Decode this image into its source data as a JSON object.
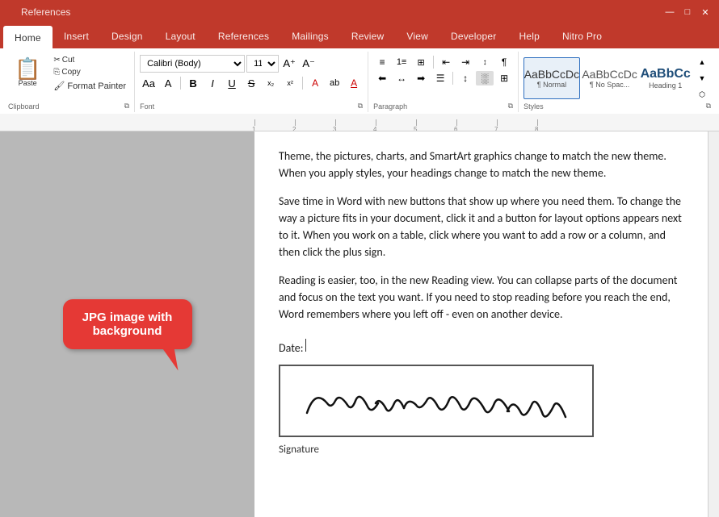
{
  "title_bar": {
    "tabs": [
      "References"
    ],
    "active_tab": "References"
  },
  "ribbon": {
    "tabs": [
      {
        "label": "Home",
        "active": true
      },
      {
        "label": "Insert"
      },
      {
        "label": "Design"
      },
      {
        "label": "Layout"
      },
      {
        "label": "References"
      },
      {
        "label": "Mailings"
      },
      {
        "label": "Review"
      },
      {
        "label": "View"
      },
      {
        "label": "Developer"
      },
      {
        "label": "Help"
      },
      {
        "label": "Nitro Pro"
      }
    ],
    "clipboard": {
      "paste_label": "Paste",
      "cut_label": "Cut",
      "copy_label": "Copy",
      "format_painter_label": "Format Painter",
      "group_label": "Clipboard"
    },
    "font": {
      "font_name": "Calibri (Body)",
      "font_size": "11",
      "bold": "B",
      "italic": "I",
      "underline": "U",
      "strikethrough": "S",
      "subscript": "x₂",
      "superscript": "x²",
      "group_label": "Font"
    },
    "paragraph": {
      "group_label": "Paragraph"
    },
    "styles": {
      "group_label": "Styles",
      "items": [
        {
          "label": "¶ Normal",
          "preview": "AaBbCcDc",
          "active": true
        },
        {
          "label": "¶ No Spac...",
          "preview": "AaBbCcDc"
        },
        {
          "label": "Heading 1",
          "preview": "AaBbCc"
        }
      ]
    }
  },
  "document": {
    "paragraphs": [
      "Theme, the pictures, charts, and SmartArt graphics change to match the new theme. When you apply styles, your headings change to match the new theme.",
      "Save time in Word with new buttons that show up where you need them. To change the way a picture fits in your document, click it and a button for layout options appears next to it. When you work on a table, click where you want to add a row or a column, and then click the plus sign.",
      "Reading is easier, too, in the new Reading view. You can collapse parts of the document and focus on the text you want. If you need to stop reading before you reach the end, Word remembers where you left off - even on another device."
    ],
    "date_label": "Date:",
    "signature_label": "Signature"
  },
  "bubble": {
    "text": "JPG image with background"
  }
}
